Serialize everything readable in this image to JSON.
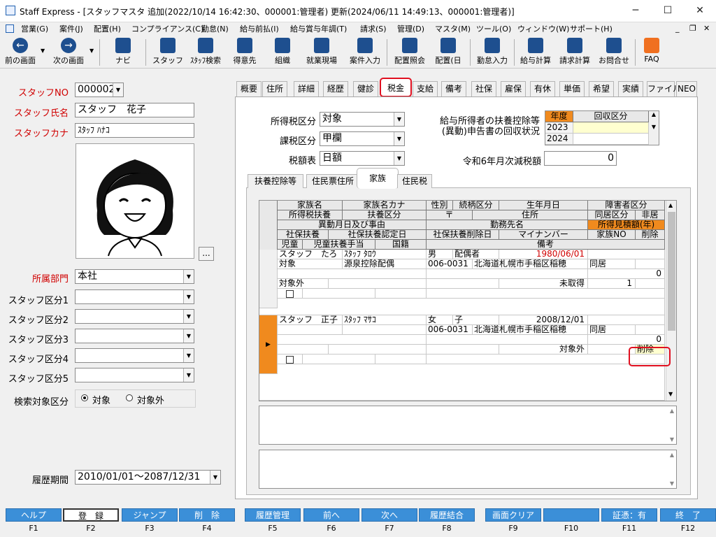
{
  "window": {
    "title": "Staff Express - [スタッフマスタ 追加(2022/10/14 16:42:30、000001:管理者) 更新(2024/06/11 14:49:13、000001:管理者)]",
    "minimize": "─",
    "maximize": "☐",
    "close": "✕"
  },
  "menu": [
    "営業(G)",
    "案件(J)",
    "配置(H)",
    "コンプライアンス(C)",
    "勤怠(N)",
    "給与前払(I)",
    "給与賞与年調(T)",
    "請求(S)",
    "管理(D)",
    "マスタ(M)",
    "ツール(O)",
    "ウィンドウ(W)",
    "サポート(H)"
  ],
  "toolbar": [
    "前の画面",
    "次の画面",
    "ナビ",
    "スタッフ",
    "ｽﾀｯﾌ検索",
    "得意先",
    "組織",
    "就業現場",
    "案件入力",
    "配置照会",
    "配置(日",
    "勤怠入力",
    "給与計算",
    "請求計算",
    "お問合せ",
    "FAQ"
  ],
  "left": {
    "staff_no_label": "スタッフNO",
    "staff_no": "000002",
    "name_label": "スタッフ氏名",
    "name": "スタッフ　花子",
    "kana_label": "スタッフカナ",
    "kana": "ｽﾀｯﾌ ﾊﾅｺ",
    "photo_button": "...",
    "dept_label": "所属部門",
    "dept": "本社",
    "kubun_labels": [
      "スタッフ区分1",
      "スタッフ区分2",
      "スタッフ区分3",
      "スタッフ区分4",
      "スタッフ区分5"
    ],
    "search_label": "検索対象区分",
    "radio_on": "対象",
    "radio_off": "対象外",
    "period_label": "履歴期間",
    "period": "2010/01/01～2087/12/31"
  },
  "tabs": [
    "概要",
    "住所",
    "詳細",
    "経歴",
    "健診",
    "税金",
    "支給",
    "備考",
    "社保",
    "雇保",
    "有休",
    "単価",
    "希望",
    "実績",
    "ファイル",
    "NEO"
  ],
  "tax": {
    "shotoku_label": "所得税区分",
    "shotoku": "対象",
    "kazei_label": "課税区分",
    "kazei": "甲欄",
    "zeigaku_label": "税額表",
    "zeigaku": "日額",
    "fuyo_title1": "給与所得者の扶養控除等",
    "fuyo_title2": "(異動)申告書の回収状況",
    "year_header": "年度",
    "kaishu_header": "回収区分",
    "years": [
      "2023",
      "2024"
    ],
    "genzei_label": "令和6年月次減税額",
    "genzei": "0"
  },
  "subtabs": [
    "扶養控除等",
    "住民票住所",
    "家族",
    "住民税"
  ],
  "grid": {
    "h1": [
      "家族名",
      "家族名カナ",
      "性別",
      "続柄区分",
      "生年月日",
      "障害者区分"
    ],
    "h2": [
      "所得税扶養",
      "扶養区分",
      "〒",
      "住所",
      "同居区分",
      "非居"
    ],
    "h3": [
      "異動月日及び事由",
      "勤務先名",
      "所得見積額(年)"
    ],
    "h4": [
      "社保扶養",
      "社保扶養認定日",
      "社保扶養削除日",
      "マイナンバー",
      "家族NO",
      "削除"
    ],
    "h5": [
      "児童",
      "児童扶養手当",
      "国籍",
      "備考"
    ],
    "rec1": {
      "name": "スタッフ　たろ",
      "kana": "ｽﾀｯﾌ ﾀﾛｳ",
      "sex": "男",
      "rel": "配偶者",
      "birth": "1980/06/01",
      "taisho": "対象",
      "fuyo": "源泉控除配偶",
      "zip": "006-0031",
      "addr": "北海道札幌市手稲区稲穂",
      "dokyo": "同居",
      "income": "0",
      "shaho": "対象外",
      "mynum": "未取得",
      "famno": "1"
    },
    "rec2": {
      "name": "スタッフ　正子",
      "kana": "ｽﾀｯﾌ ﾏｻｺ",
      "sex": "女",
      "rel": "子",
      "birth": "2008/12/01",
      "zip": "006-0031",
      "addr": "北海道札幌市手稲区稲穂",
      "dokyo": "同居",
      "income": "0",
      "mynum": "対象外",
      "del": "削除"
    }
  },
  "fkeys": [
    {
      "label": "ヘルプ",
      "key": "F1"
    },
    {
      "label": "登　録",
      "key": "F2"
    },
    {
      "label": "ジャンプ",
      "key": "F3"
    },
    {
      "label": "削　除",
      "key": "F4"
    },
    {
      "label": "履歴管理",
      "key": "F5"
    },
    {
      "label": "前へ",
      "key": "F6"
    },
    {
      "label": "次へ",
      "key": "F7"
    },
    {
      "label": "履歴結合",
      "key": "F8"
    },
    {
      "label": "画面クリア",
      "key": "F9"
    },
    {
      "label": "",
      "key": "F10"
    },
    {
      "label": "証憑：有",
      "key": "F11"
    },
    {
      "label": "終　了",
      "key": "F12"
    }
  ],
  "colors": {
    "accent_red": "#d00000",
    "fkey_blue": "#3b8fd8",
    "orange": "#f08a1e",
    "highlight": "#e01020"
  }
}
